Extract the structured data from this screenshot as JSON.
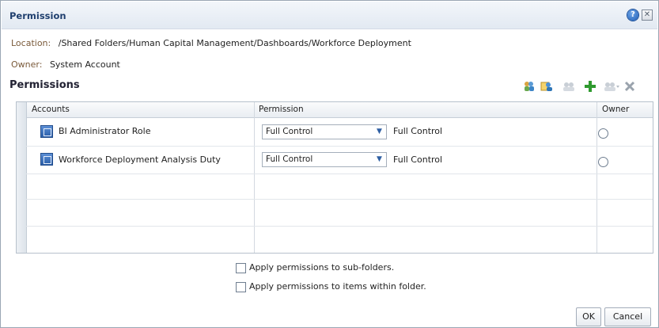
{
  "dialog": {
    "title": "Permission",
    "help_symbol": "?",
    "close_symbol": "✕"
  },
  "location": {
    "label": "Location:",
    "value": "/Shared Folders/Human Capital Management/Dashboards/Workforce Deployment"
  },
  "owner": {
    "label": "Owner:",
    "value": "System Account"
  },
  "permissions_section": {
    "title": "Permissions"
  },
  "toolbar": {
    "icons": [
      "users-search-icon",
      "users-edit-icon",
      "users-disabled-icon",
      "add-icon",
      "users-more-disabled-icon",
      "delete-icon"
    ],
    "delete_symbol": "✕",
    "add_symbol": "+",
    "dropdown_symbol": "▾"
  },
  "table": {
    "headers": {
      "accounts": "Accounts",
      "permission": "Permission",
      "owner": "Owner"
    },
    "rows": [
      {
        "account": "BI Administrator Role",
        "permission_select": "Full Control",
        "permission_text": "Full Control"
      },
      {
        "account": "Workforce Deployment Analysis Duty",
        "permission_select": "Full Control",
        "permission_text": "Full Control"
      }
    ]
  },
  "options": {
    "subfolders": "Apply permissions to sub-folders.",
    "items": "Apply permissions to items within folder."
  },
  "buttons": {
    "ok": "OK",
    "cancel": "Cancel"
  },
  "colors": {
    "title_text": "#1f3f6e",
    "label_text": "#7a5a3a",
    "accent_blue": "#2f5fa3",
    "add_green": "#2f9a2f",
    "delete_gray": "#9aa3ad"
  }
}
